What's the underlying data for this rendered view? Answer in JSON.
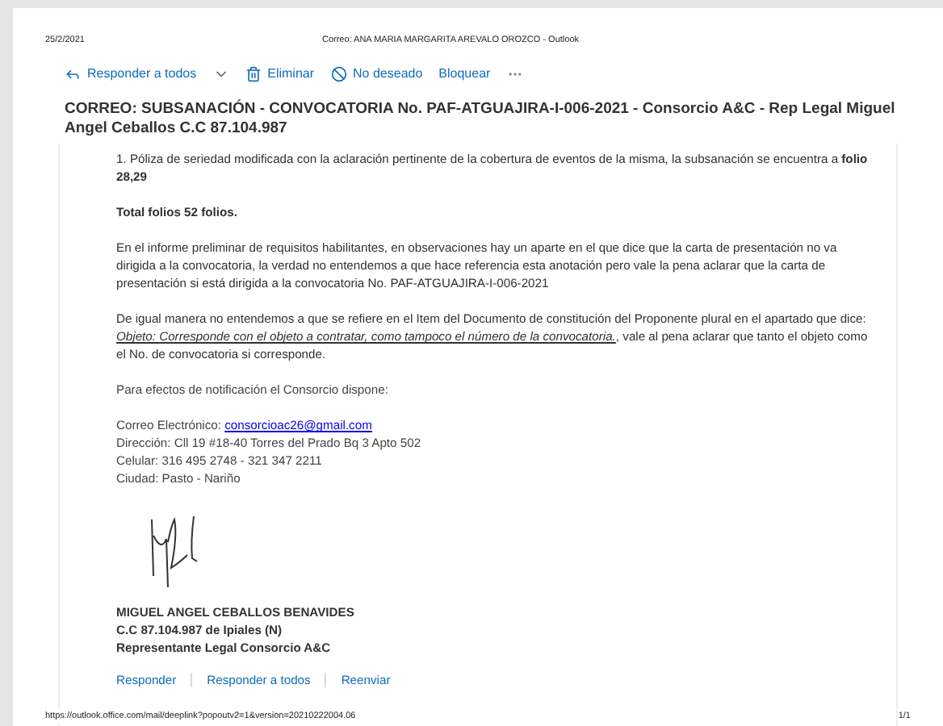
{
  "print_header": {
    "date": "25/2/2021",
    "title": "Correo: ANA MARIA MARGARITA AREVALO OROZCO - Outlook"
  },
  "toolbar": [
    {
      "kind": "reply-all",
      "label": "Responder a todos"
    },
    {
      "kind": "dropdown"
    },
    {
      "kind": "delete",
      "label": "Eliminar"
    },
    {
      "kind": "junk",
      "label": "No deseado"
    },
    {
      "kind": "plain",
      "label": "Bloquear"
    },
    {
      "kind": "more"
    }
  ],
  "subject": "CORREO: SUBSANACIÓN - CONVOCATORIA No. PAF-ATGUAJIRA-I-006-2021 - Consorcio A&C - Rep Legal Miguel Angel Ceballos C.C 87.104.987",
  "body": [
    {
      "kind": "rich",
      "text": "1. Póliza de seriedad modificada con la aclaración pertinente de la cobertura de eventos de la misma, la subsanación se encuentra a **folio 28,29**"
    },
    {
      "kind": "bold",
      "text": "Total folios 52 folios."
    },
    {
      "kind": "rich",
      "text": "En el informe preliminar de requisitos habilitantes, en observaciones hay un aparte en el que dice que la carta de presentación no va dirigida a la convocatoria, la verdad no entendemos a que hace referencia esta anotación pero vale la pena aclarar que la carta de presentación si está dirigida a la convocatoria No. PAF-ATGUAJIRA-I-006-2021"
    },
    {
      "kind": "quoted",
      "before": "De igual manera no entendemos a que se refiere en el  Item del Documento de constitución del Proponente plural en el apartado que dice: ",
      "quote": "Objeto: Corresponde con el objeto a contratar, como tampoco el número de la convocatoria.",
      "after": ", vale al pena aclarar que tanto el objeto como el No. de convocatoria si corresponde."
    }
  ],
  "notice": "Para efectos de notificación el Consorcio dispone:",
  "contact": {
    "email_label": "Correo Electrónico:",
    "email": "consorcioac26@gmail.com",
    "lines": [
      "Dirección: Cll 19 #18-40 Torres del Prado Bq 3 Apto 502",
      "Celular: 316 495 2748 - 321 347 2211",
      "Ciudad: Pasto - Nariño"
    ]
  },
  "signature": [
    "MIGUEL ANGEL CEBALLOS BENAVIDES",
    "C.C 87.104.987 de Ipiales (N)",
    "Representante Legal Consorcio A&C"
  ],
  "actions": [
    "Responder",
    "Responder a todos",
    "Reenviar"
  ],
  "footer": {
    "url": "https://outlook.office.com/mail/deeplink?popoutv2=1&version=20210222004.06",
    "page": "1/1"
  }
}
